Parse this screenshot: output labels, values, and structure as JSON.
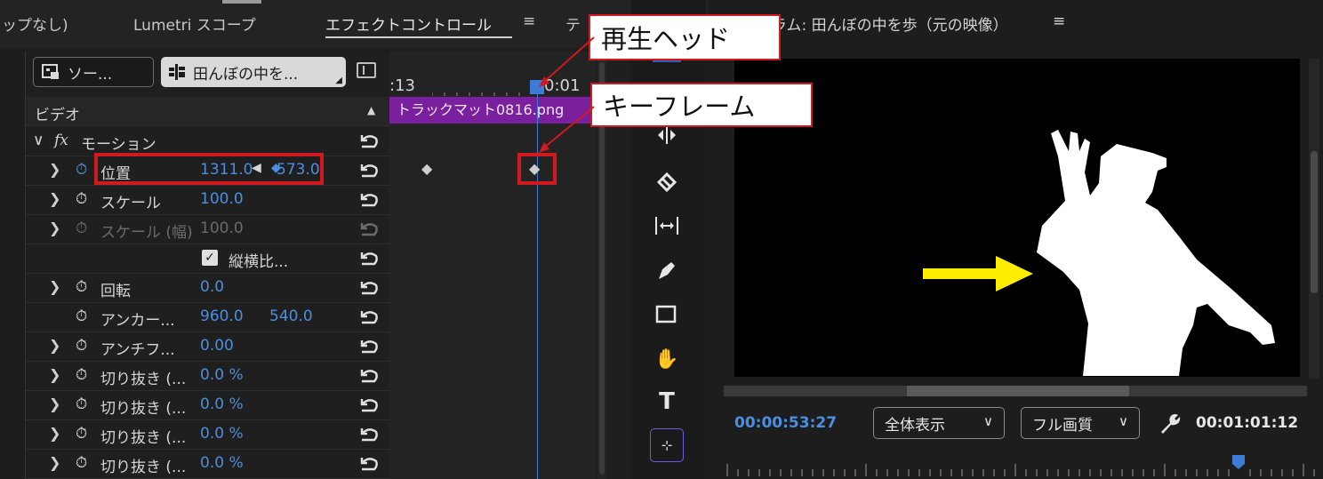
{
  "tabs": {
    "tab1": "ップなし)",
    "tab2": "Lumetri スコープ",
    "tab3": "エフェクトコントロール",
    "tab3_menu": "≡",
    "tab4": "テ"
  },
  "effect_controls": {
    "source_button": "ソー...",
    "clip_button": "田んぼの中を...",
    "section_label": "ビデオ",
    "motion_label": "モーション",
    "timecode_start": ":13",
    "timecode_end": "0:01",
    "clip_name": "トラックマット0816.png",
    "properties": [
      {
        "label": "位置",
        "v1": "1311.0",
        "v2": "573.0"
      },
      {
        "label": "スケール",
        "v1": "100.0"
      },
      {
        "label": "スケール (幅)",
        "v1": "100.0"
      },
      {
        "label": "縦横比..."
      },
      {
        "label": "回転",
        "v1": "0.0"
      },
      {
        "label": "アンカー...",
        "v1": "960.0",
        "v2": "540.0"
      },
      {
        "label": "アンチフ...",
        "v1": "0.00"
      },
      {
        "label": "切り抜き (...",
        "v1": "0.0 %"
      },
      {
        "label": "切り抜き (...",
        "v1": "0.0 %"
      },
      {
        "label": "切り抜き (...",
        "v1": "0.0 %"
      },
      {
        "label": "切り抜き (...",
        "v1": "0.0 %"
      }
    ]
  },
  "monitor": {
    "title": "ラム: 田んぼの中を歩（元の映像）",
    "menu": "≡",
    "current_time": "00:00:53:27",
    "zoom_select": "全体表示",
    "quality_select": "フル画質",
    "duration": "00:01:01:12"
  },
  "annotations": {
    "playhead_callout": "再生ヘッド",
    "keyframe_callout": "キーフレーム"
  },
  "colors": {
    "accent_blue": "#4a8fe0",
    "clip_purple": "#7a1f9e",
    "annotation_red": "#d2191f",
    "arrow_yellow": "#ffee00"
  }
}
